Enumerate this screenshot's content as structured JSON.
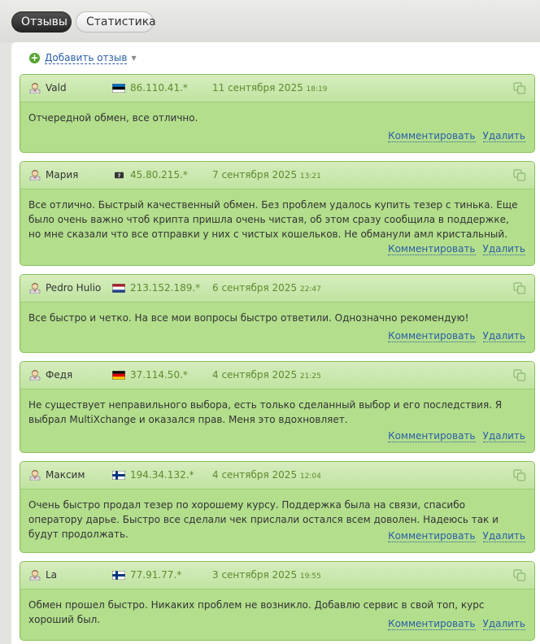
{
  "tabs": {
    "reviews": "Отзывы",
    "stats": "Статистика"
  },
  "add_review": "Добавить отзыв",
  "actions": {
    "comment": "Комментировать",
    "delete": "Удалить"
  },
  "colors": {
    "card_bg": "#b3de8c",
    "card_border": "#89c05a",
    "accent_green": "#5e8a2e",
    "link": "#2a5ea8"
  },
  "reviews": [
    {
      "name": "Vald",
      "flag": "estonia-flag-icon",
      "ip": "86.110.41.*",
      "date": "11 сентября 2025",
      "time": "18:19",
      "text": "Отчередной обмен, все отлично."
    },
    {
      "name": "Мария",
      "flag": "unknown-flag-icon",
      "ip": "45.80.215.*",
      "date": "7 сентября 2025",
      "time": "13:21",
      "text": "Все отлично. Быстрый качественный обмен. Без проблем удалось купить тезер с тинька. Еще было очень важно чтоб крипта пришла очень чистая, об этом сразу сообщила в поддержке, но мне сказали что все отправки у них с чистых кошельков. Не обманули амл кристальный."
    },
    {
      "name": "Pedro Hulio",
      "flag": "netherlands-flag-icon",
      "ip": "213.152.189.*",
      "date": "6 сентября 2025",
      "time": "22:47",
      "text": "Все быстро и четко. На все мои вопросы быстро ответили. Однозначно рекомендую!"
    },
    {
      "name": "Федя",
      "flag": "germany-flag-icon",
      "ip": "37.114.50.*",
      "date": "4 сентября 2025",
      "time": "21:25",
      "text": "Не существует неправильного выбора, есть только сделанный выбор и его последствия. Я выбрал MultiXchange и оказался прав. Меня это вдохновляет."
    },
    {
      "name": "Максим",
      "flag": "finland-flag-icon",
      "ip": "194.34.132.*",
      "date": "4 сентября 2025",
      "time": "12:04",
      "text": "Очень быстро продал тезер по хорошему курсу. Поддержка была на связи, спасибо оператору дарье. Быстро все сделали чек прислали остался всем доволен. Надеюсь так и будут продолжать."
    },
    {
      "name": "La",
      "flag": "finland-flag-icon",
      "ip": "77.91.77.*",
      "date": "3 сентября 2025",
      "time": "19:55",
      "text": "Обмен прошел быстро. Никаких проблем не возникло. Добавлю сервис в свой топ, курс хороший был."
    }
  ]
}
